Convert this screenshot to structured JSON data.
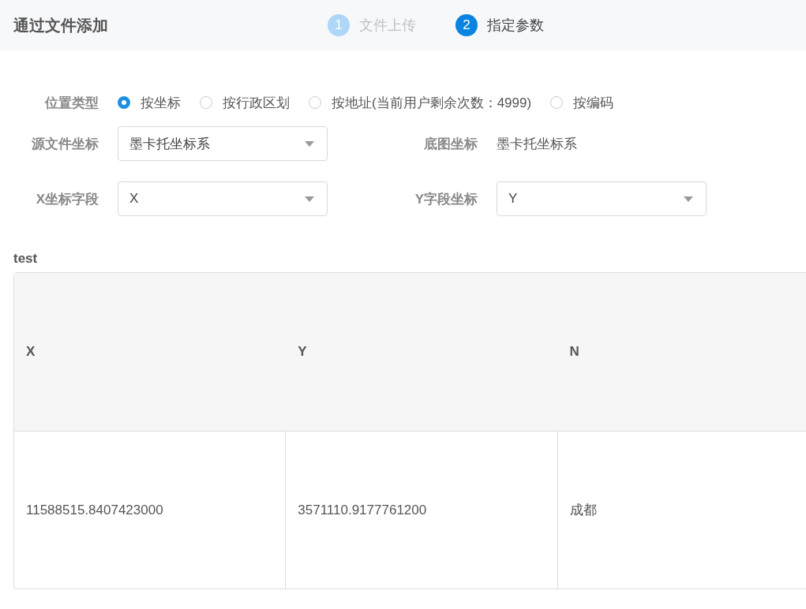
{
  "header": {
    "title": "通过文件添加",
    "steps": [
      {
        "number": "1",
        "label": "文件上传",
        "active": false
      },
      {
        "number": "2",
        "label": "指定参数",
        "active": true
      }
    ]
  },
  "form": {
    "location_type": {
      "label": "位置类型",
      "options": [
        {
          "label": "按坐标",
          "selected": true
        },
        {
          "label": "按行政区划",
          "selected": false
        },
        {
          "label": "按地址(当前用户剩余次数：4999)",
          "selected": false
        },
        {
          "label": "按编码",
          "selected": false
        }
      ]
    },
    "source_crs": {
      "label": "源文件坐标",
      "value": "墨卡托坐标系"
    },
    "base_crs": {
      "label": "底图坐标",
      "value": "墨卡托坐标系"
    },
    "x_field": {
      "label": "X坐标字段",
      "value": "X"
    },
    "y_field": {
      "label": "Y字段坐标",
      "value": "Y"
    }
  },
  "table": {
    "title": "test",
    "columns": [
      "X",
      "Y",
      "N"
    ],
    "rows": [
      [
        "11588515.8407423000",
        "3571110.9177761200",
        "成都"
      ]
    ]
  }
}
